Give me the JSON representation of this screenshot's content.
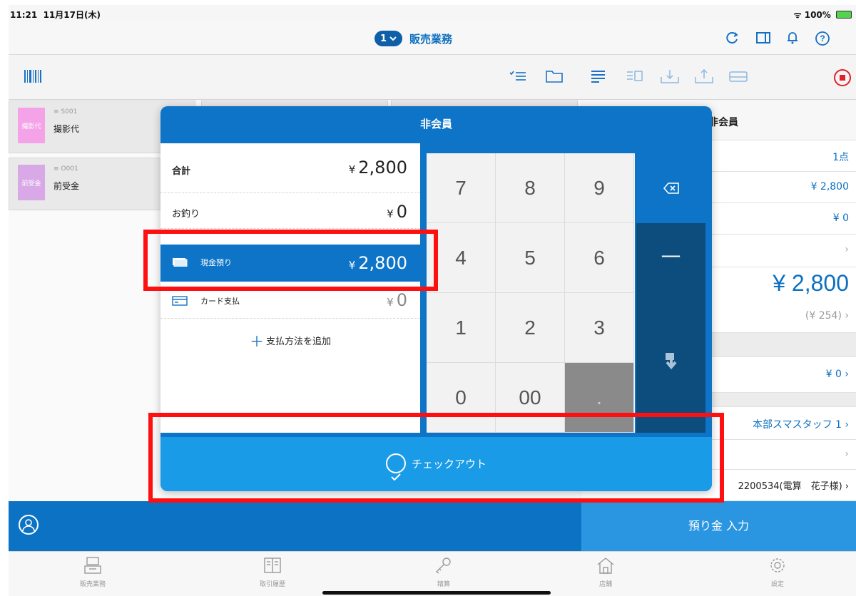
{
  "status": {
    "time": "11:21",
    "date": "11月17日(木)",
    "battery": "100%"
  },
  "nav": {
    "badge": "1",
    "title": "販売業務"
  },
  "products": [
    {
      "chip": "撮影代",
      "code": "≡ S001",
      "name": "撮影代",
      "color": "#f4a3e8"
    },
    {
      "chip": "前受金",
      "code": "≡ O001",
      "name": "前受金",
      "color": "#d8a9e6"
    }
  ],
  "right_panel": {
    "member": "非会員",
    "count": "1点",
    "subtotal": "¥ 2,800",
    "discount": "¥ 0",
    "total": "¥ 2,800",
    "tax": "(¥ 254)",
    "points": "¥ 0",
    "staff": "本部スマスタッフ 1",
    "customer": "2200534(電算　花子様)"
  },
  "modal": {
    "title": "非会員",
    "rows": [
      {
        "label": "合計",
        "currency": "¥",
        "amount": "2,800"
      },
      {
        "label": "お釣り",
        "currency": "¥",
        "amount": "0"
      },
      {
        "label": "現金預り",
        "currency": "¥",
        "amount": "2,800"
      },
      {
        "label": "カード支払",
        "currency": "¥",
        "amount": "0"
      }
    ],
    "add_payment": "支払方法を追加",
    "keys": [
      "7",
      "8",
      "9",
      "4",
      "5",
      "6",
      "1",
      "2",
      "3",
      "0",
      "00",
      "."
    ],
    "minus": "—",
    "checkout": "チェックアウト"
  },
  "actionbar": {
    "deposit": "預り金 入力"
  },
  "tabs": [
    "販売業務",
    "取引履歴",
    "精算",
    "店舗",
    "設定"
  ],
  "colors": {
    "accent": "#0d74c7",
    "highlight": "#ff1010"
  }
}
